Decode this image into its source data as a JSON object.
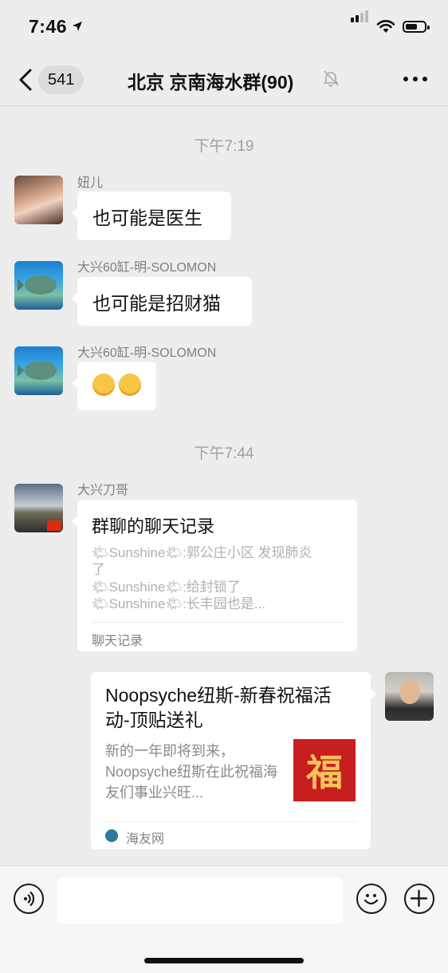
{
  "status_bar": {
    "time": "7:46"
  },
  "nav": {
    "back_count": "541",
    "title": "北京 京南海水群(90)"
  },
  "messages": [
    {
      "timestamp": "下午7:19"
    },
    {
      "sender": "妞儿",
      "text": "也可能是医生"
    },
    {
      "sender": "大兴60缸-明-SOLOMON",
      "text": "也可能是招财猫"
    },
    {
      "sender": "大兴60缸-明-SOLOMON",
      "emoji": [
        "grin-emoji",
        "grin-emoji"
      ]
    },
    {
      "timestamp": "下午7:44"
    },
    {
      "sender": "大兴刀哥",
      "chat_record": {
        "title": "群聊的聊天记录",
        "lines": [
          "🌤Sunshine🌤:郭公庄小区 发现肺炎",
          "了",
          "🌤Sunshine🌤:给封锁了",
          "🌤Sunshine🌤:长丰园也是..."
        ],
        "footer": "聊天记录"
      }
    },
    {
      "own": true,
      "link_card": {
        "title": "Noopsyche纽斯-新春祝福活动-顶贴送礼",
        "description": "新的一年即将到来，Noopsyche纽斯在此祝福海友们事业兴旺...",
        "thumbnail_text": "福",
        "source": "海友网"
      }
    }
  ],
  "input_bar": {
    "placeholder": ""
  },
  "colors": {
    "background": "#ededed",
    "bubble": "#ffffff",
    "timestamp": "#a0a0a0"
  }
}
